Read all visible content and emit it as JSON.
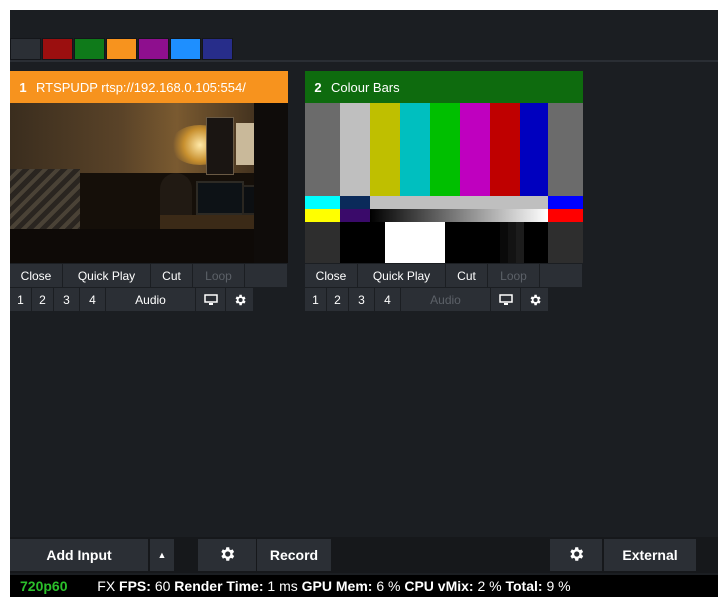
{
  "colors": {
    "background": "#1b1e22",
    "button": "#2b2f35",
    "input1_header": "#f7931e",
    "input2_header": "#0e6b0e",
    "status_format": "#2bc02b"
  },
  "color_tabs": [
    {
      "name": "none",
      "color": "#2b2f35"
    },
    {
      "name": "red",
      "color": "#9b0f0f"
    },
    {
      "name": "green",
      "color": "#0f7a1a"
    },
    {
      "name": "orange",
      "color": "#f7931e"
    },
    {
      "name": "purple",
      "color": "#8e0f8e"
    },
    {
      "name": "blue",
      "color": "#1e8fff"
    },
    {
      "name": "navy",
      "color": "#272d8a"
    }
  ],
  "inputs": [
    {
      "number": "1",
      "title": "RTSPUDP rtsp://192.168.0.105:554/",
      "header_color": "#f7931e",
      "buttons": {
        "close": "Close",
        "quick_play": "Quick Play",
        "cut": "Cut",
        "loop": "Loop"
      },
      "overlays": [
        "1",
        "2",
        "3",
        "4"
      ],
      "audio": "Audio"
    },
    {
      "number": "2",
      "title": "Colour Bars",
      "header_color": "#0e6b0e",
      "buttons": {
        "close": "Close",
        "quick_play": "Quick Play",
        "cut": "Cut",
        "loop": "Loop"
      },
      "overlays": [
        "1",
        "2",
        "3",
        "4"
      ],
      "audio": "Audio"
    }
  ],
  "icons": {
    "monitor": "monitor-icon",
    "settings": "gear-icon",
    "dropdown": "caret-up-icon"
  },
  "toolbar": {
    "add_input": "Add Input",
    "record": "Record",
    "external": "External"
  },
  "status": {
    "format": "720p60",
    "fx": "FX",
    "fps_label": "FPS:",
    "fps_value": "60",
    "render_label": "Render Time:",
    "render_value": "1 ms",
    "gpu_label": "GPU Mem:",
    "gpu_value": "6 %",
    "cpu_label": "CPU vMix:",
    "cpu_value": "2 %",
    "total_label": "Total:",
    "total_value": "9 %"
  }
}
